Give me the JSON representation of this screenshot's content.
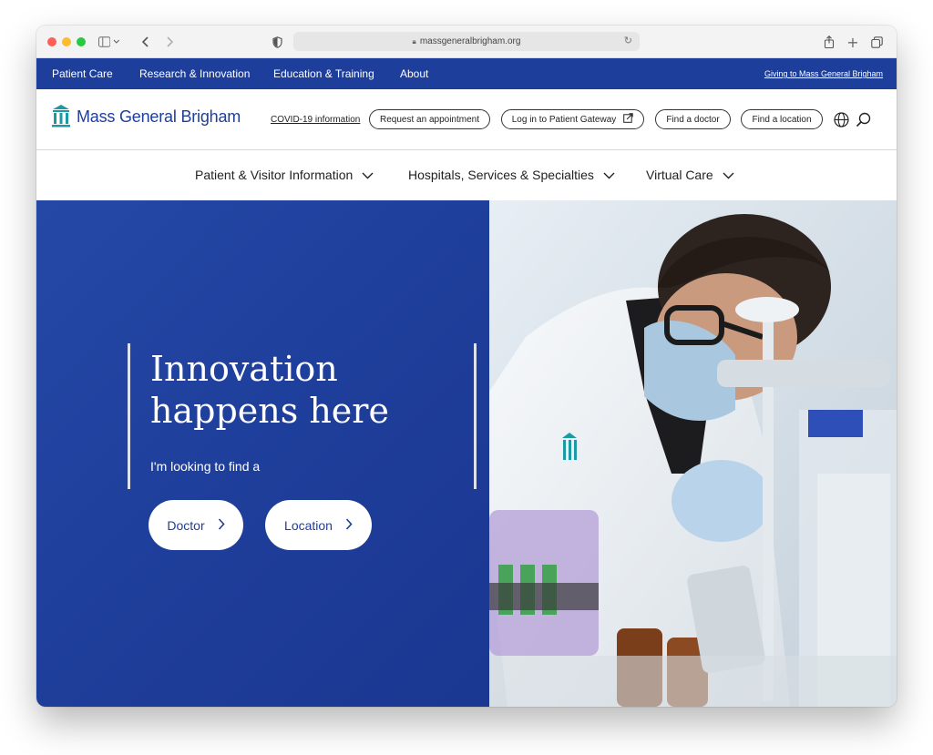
{
  "browser": {
    "url": "massgeneralbrigham.org"
  },
  "topbar": {
    "links": [
      "Patient Care",
      "Research & Innovation",
      "Education & Training",
      "About"
    ],
    "giving": "Giving to Mass General Brigham"
  },
  "header": {
    "logo_text": "Mass General Brigham",
    "covid": "COVID-19 information",
    "buttons": [
      "Request an appointment",
      "Log in to Patient Gateway",
      "Find a doctor",
      "Find a location"
    ]
  },
  "nav": {
    "items": [
      "Patient & Visitor Information",
      "Hospitals, Services & Specialties",
      "Virtual Care"
    ]
  },
  "hero": {
    "title": "Innovation\nhappens here",
    "subtitle": "I'm looking to find a",
    "buttons": [
      "Doctor",
      "Location"
    ]
  },
  "colors": {
    "brand_blue": "#1e3e9b",
    "logo_teal": "#1b9aa3"
  },
  "icons": [
    "sidebar-icon",
    "back-icon",
    "forward-icon",
    "shield-icon",
    "lock-icon",
    "reload-icon",
    "share-icon",
    "new-tab-icon",
    "tabs-icon",
    "external-link-icon",
    "globe-icon",
    "search-icon",
    "chevron-down-icon",
    "chevron-right-icon"
  ]
}
